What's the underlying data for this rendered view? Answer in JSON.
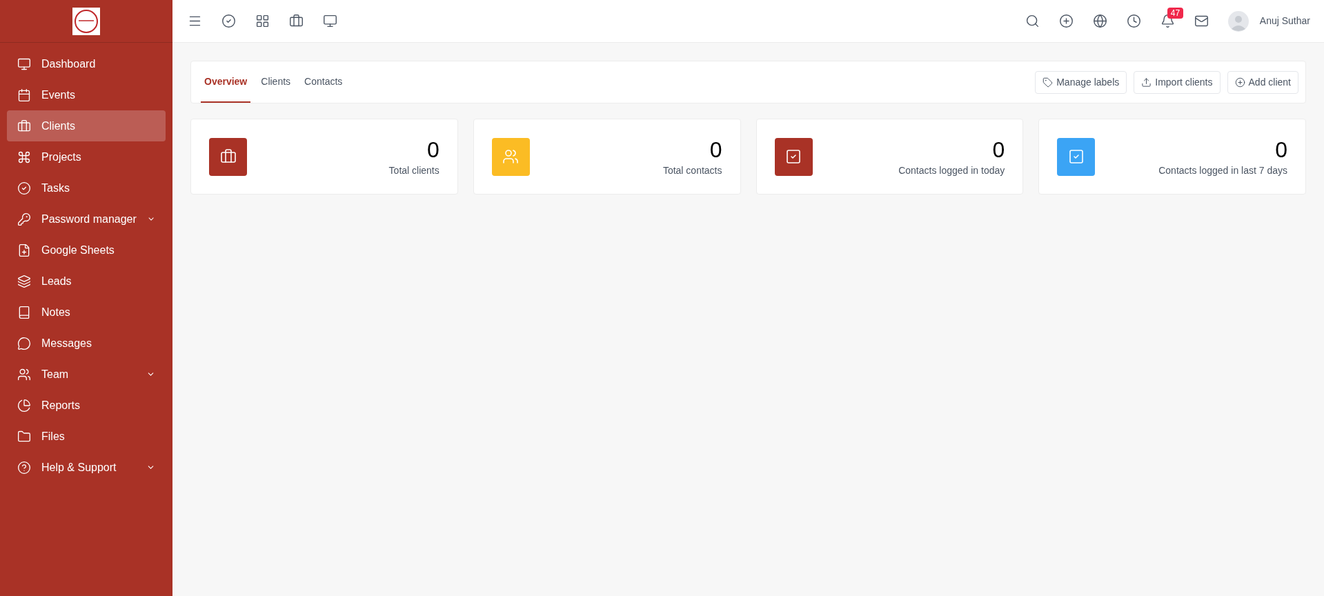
{
  "sidebar": {
    "items": [
      {
        "label": "Dashboard",
        "selected": false,
        "has_submenu": false
      },
      {
        "label": "Events",
        "selected": false,
        "has_submenu": false
      },
      {
        "label": "Clients",
        "selected": true,
        "has_submenu": false
      },
      {
        "label": "Projects",
        "selected": false,
        "has_submenu": false
      },
      {
        "label": "Tasks",
        "selected": false,
        "has_submenu": false
      },
      {
        "label": "Password manager",
        "selected": false,
        "has_submenu": true
      },
      {
        "label": "Google Sheets",
        "selected": false,
        "has_submenu": false
      },
      {
        "label": "Leads",
        "selected": false,
        "has_submenu": false
      },
      {
        "label": "Notes",
        "selected": false,
        "has_submenu": false
      },
      {
        "label": "Messages",
        "selected": false,
        "has_submenu": false
      },
      {
        "label": "Team",
        "selected": false,
        "has_submenu": true
      },
      {
        "label": "Reports",
        "selected": false,
        "has_submenu": false
      },
      {
        "label": "Files",
        "selected": false,
        "has_submenu": false
      },
      {
        "label": "Help & Support",
        "selected": false,
        "has_submenu": true
      }
    ]
  },
  "topbar": {
    "notification_count": "47",
    "user_name": "Anuj Suthar"
  },
  "tabs": [
    {
      "label": "Overview",
      "selected": true
    },
    {
      "label": "Clients",
      "selected": false
    },
    {
      "label": "Contacts",
      "selected": false
    }
  ],
  "actions": [
    "Manage labels",
    "Import clients",
    "Add client"
  ],
  "stats": [
    {
      "value": "0",
      "label": "Total clients",
      "color": "#a93226"
    },
    {
      "value": "0",
      "label": "Total contacts",
      "color": "#fbbc24"
    },
    {
      "value": "0",
      "label": "Contacts logged in today",
      "color": "#a93226"
    },
    {
      "value": "0",
      "label": "Contacts logged in last 7 days",
      "color": "#3ba4f5"
    }
  ]
}
